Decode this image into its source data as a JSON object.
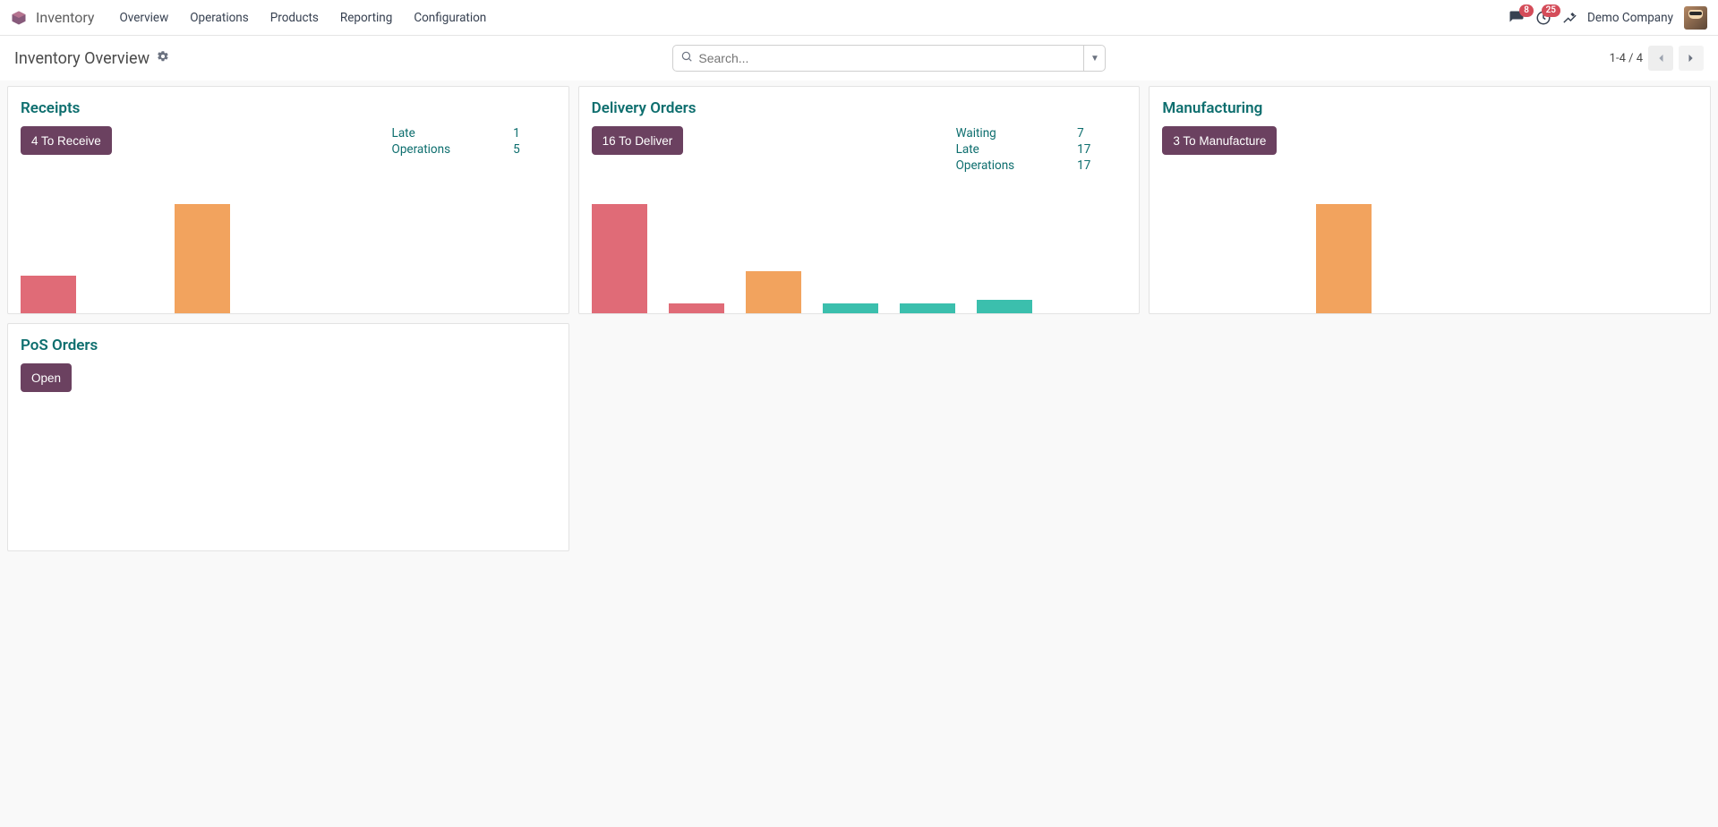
{
  "nav": {
    "app_name": "Inventory",
    "links": [
      "Overview",
      "Operations",
      "Products",
      "Reporting",
      "Configuration"
    ],
    "messages_badge": "8",
    "activities_badge": "25",
    "company": "Demo Company"
  },
  "controlbar": {
    "title": "Inventory Overview",
    "search_placeholder": "Search...",
    "pager_text": "1-4 / 4"
  },
  "cards": {
    "receipts": {
      "title": "Receipts",
      "button": "4 To Receive",
      "stats": [
        {
          "label": "Late",
          "value": "1"
        },
        {
          "label": "Operations",
          "value": "5"
        }
      ]
    },
    "delivery": {
      "title": "Delivery Orders",
      "button": "16 To Deliver",
      "stats": [
        {
          "label": "Waiting",
          "value": "7"
        },
        {
          "label": "Late",
          "value": "17"
        },
        {
          "label": "Operations",
          "value": "17"
        }
      ]
    },
    "manufacturing": {
      "title": "Manufacturing",
      "button": "3 To Manufacture"
    },
    "pos": {
      "title": "PoS Orders",
      "button": "Open"
    }
  },
  "chart_data": [
    {
      "type": "bar",
      "title": "Receipts",
      "categories": [
        "",
        "",
        ""
      ],
      "values": [
        42,
        0,
        122
      ],
      "colors": [
        "#e06b77",
        "transparent",
        "#f2a35e"
      ]
    },
    {
      "type": "bar",
      "title": "Delivery Orders",
      "categories": [
        "",
        "",
        "",
        "",
        "",
        ""
      ],
      "values": [
        114,
        10,
        44,
        10,
        10,
        14
      ],
      "colors": [
        "#e06b77",
        "#e06b77",
        "#f2a35e",
        "#3bbfad",
        "#3bbfad",
        "#3bbfad"
      ]
    },
    {
      "type": "bar",
      "title": "Manufacturing",
      "categories": [
        "",
        "",
        "",
        ""
      ],
      "values": [
        0,
        0,
        122,
        0
      ],
      "colors": [
        "transparent",
        "transparent",
        "#f2a35e",
        "transparent"
      ]
    }
  ]
}
